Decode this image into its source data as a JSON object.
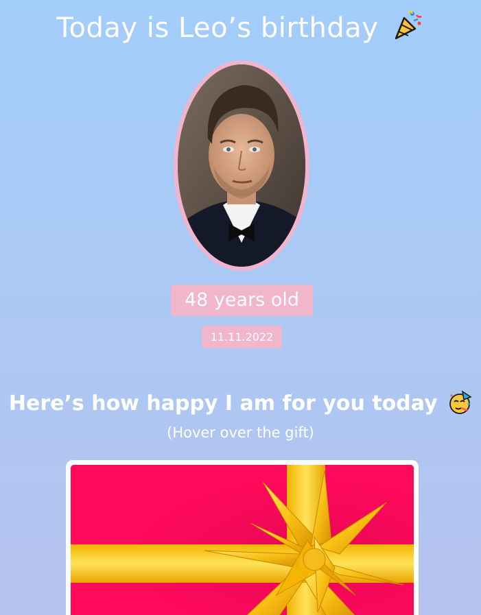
{
  "header": {
    "title": "Today is Leo’s birthday",
    "title_icon": "party-popper-icon"
  },
  "profile": {
    "photo": "portrait-photo",
    "age_text": "48 years old",
    "date": "11.11.2022"
  },
  "message": {
    "text": "Here’s how happy I am for you today",
    "icon": "partying-face-icon",
    "hint": "(Hover over the gift)"
  },
  "gift": {
    "box_color": "#ff0a5b",
    "ribbon_color": "#ffd21a",
    "frame_color": "#ffffff"
  },
  "colors": {
    "badge_bg": "#f2b6cc",
    "bg_top": "#a3cdfa",
    "bg_bottom": "#b6c3ee"
  }
}
